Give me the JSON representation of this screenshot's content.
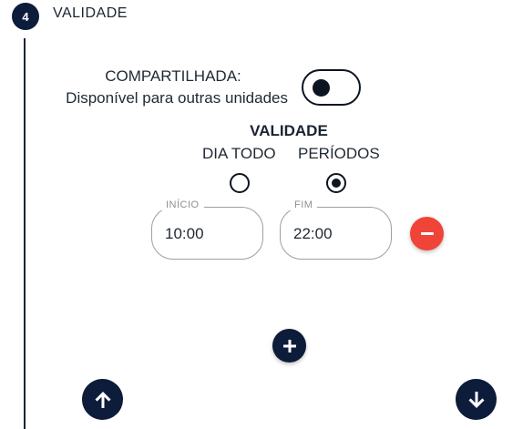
{
  "step": {
    "number": "4",
    "title": "VALIDADE"
  },
  "shared": {
    "label_line1": "COMPARTILHADA:",
    "label_line2": "Disponível para outras unidades",
    "toggle_on": false
  },
  "validade": {
    "heading": "VALIDADE",
    "options": [
      {
        "label": "DIA TODO",
        "selected": false
      },
      {
        "label": "PERÍODOS",
        "selected": true
      }
    ]
  },
  "period": {
    "start_label": "INÍCIO",
    "start_value": "10:00",
    "end_label": "FIM",
    "end_value": "22:00"
  },
  "icons": {
    "remove": "minus-icon",
    "add": "plus-icon",
    "up": "arrow-up-icon",
    "down": "arrow-down-icon"
  },
  "colors": {
    "primary": "#0c1c3a",
    "danger": "#f04438",
    "border": "#9aa0a6"
  }
}
